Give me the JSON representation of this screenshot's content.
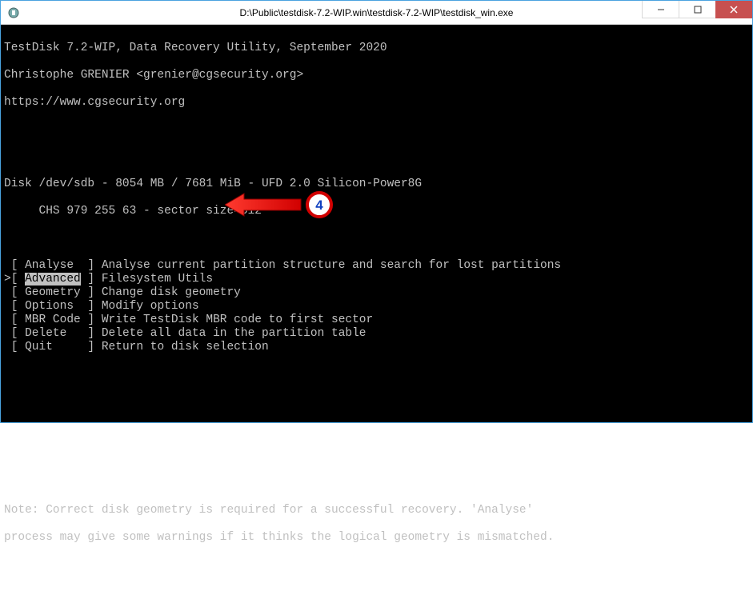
{
  "window": {
    "title": "D:\\Public\\testdisk-7.2-WIP.win\\testdisk-7.2-WIP\\testdisk_win.exe"
  },
  "header": {
    "line1": "TestDisk 7.2-WIP, Data Recovery Utility, September 2020",
    "line2": "Christophe GRENIER <grenier@cgsecurity.org>",
    "line3": "https://www.cgsecurity.org"
  },
  "disk": {
    "line1": "Disk /dev/sdb - 8054 MB / 7681 MiB - UFD 2.0 Silicon-Power8G",
    "line2": "     CHS 979 255 63 - sector size=512"
  },
  "menu": [
    {
      "prefix": " [ ",
      "label": "Analyse ",
      "suffix": " ] ",
      "desc": "Analyse current partition structure and search for lost partitions",
      "selected": false
    },
    {
      "prefix": ">[ ",
      "label": "Advanced",
      "suffix": " ] ",
      "desc": "Filesystem Utils",
      "selected": true
    },
    {
      "prefix": " [ ",
      "label": "Geometry",
      "suffix": " ] ",
      "desc": "Change disk geometry",
      "selected": false
    },
    {
      "prefix": " [ ",
      "label": "Options ",
      "suffix": " ] ",
      "desc": "Modify options",
      "selected": false
    },
    {
      "prefix": " [ ",
      "label": "MBR Code",
      "suffix": " ] ",
      "desc": "Write TestDisk MBR code to first sector",
      "selected": false
    },
    {
      "prefix": " [ ",
      "label": "Delete  ",
      "suffix": " ] ",
      "desc": "Delete all data in the partition table",
      "selected": false
    },
    {
      "prefix": " [ ",
      "label": "Quit    ",
      "suffix": " ] ",
      "desc": "Return to disk selection",
      "selected": false
    }
  ],
  "note": {
    "line1": "Note: Correct disk geometry is required for a successful recovery. 'Analyse'",
    "line2": "process may give some warnings if it thinks the logical geometry is mismatched."
  },
  "annotation": {
    "number": "4"
  }
}
